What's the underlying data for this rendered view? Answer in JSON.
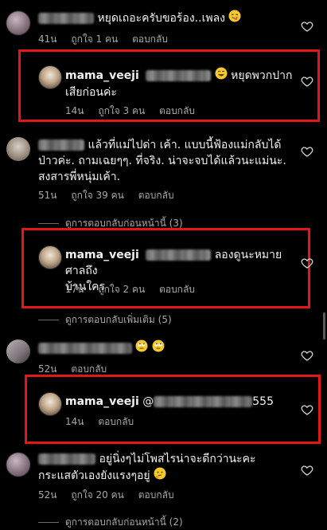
{
  "comments": [
    {
      "text": "หยุดเถอะครับขอร้อง..เพลง",
      "time": "41น",
      "likes": "ถูกใจ 1 คน",
      "reply": "ตอบกลับ"
    },
    {
      "username": "mama_veeji",
      "text_line1": "หยุดพวกปาก",
      "text_line2": "เสียก่อนค่ะ",
      "time": "14น",
      "likes": "ถูกใจ 3 คน",
      "reply": "ตอบกลับ"
    },
    {
      "text_line1": "แล้วที่แม่ไปด่า เค้า. แบบนี้ฟ้องแม่กลับได้",
      "text_line2": "ป่าวค่ะ. ถามเฉยๆๆ. ที่จริง. น่าจะจบได้แล้วนะแม่นะ.",
      "text_line3": "สงสารพี่หนุ่มเค้า.",
      "time": "51น",
      "likes": "ถูกใจ 39 คน",
      "reply": "ตอบกลับ"
    },
    {
      "username": "mama_veeji",
      "text_line1": "ลองดูนะหมายศาลถึง",
      "text_line2": "บ้านใคร",
      "time": "17น",
      "likes": "ถูกใจ 2 คน",
      "reply": "ตอบกลับ"
    },
    {
      "time": "52น",
      "reply": "ตอบกลับ"
    },
    {
      "username": "mama_veeji",
      "text_prefix": "@",
      "text_suffix": "555",
      "time": "14น",
      "reply": "ตอบกลับ"
    },
    {
      "text_line1": "อยู่นิ่งๆไม่โพสไรน่าจะดีกว่านะคะ",
      "text_line2": "กระแสตัวเองยังแรงๆอยู่",
      "time": "52น",
      "likes": "ถูกใจ 20 คน",
      "reply": "ตอบกลับ"
    }
  ],
  "view_links": {
    "previous_replies_1": "ดูการตอบกลับก่อนหน้านี้ (3)",
    "more_replies": "ดูการตอบกลับเพิ่มเติม (5)",
    "previous_replies_2": "ดูการตอบกลับก่อนหน้านี้ (2)"
  },
  "colors": {
    "background": "#000000",
    "highlight_box": "#e41717",
    "secondary_text": "#a8a8a8"
  }
}
